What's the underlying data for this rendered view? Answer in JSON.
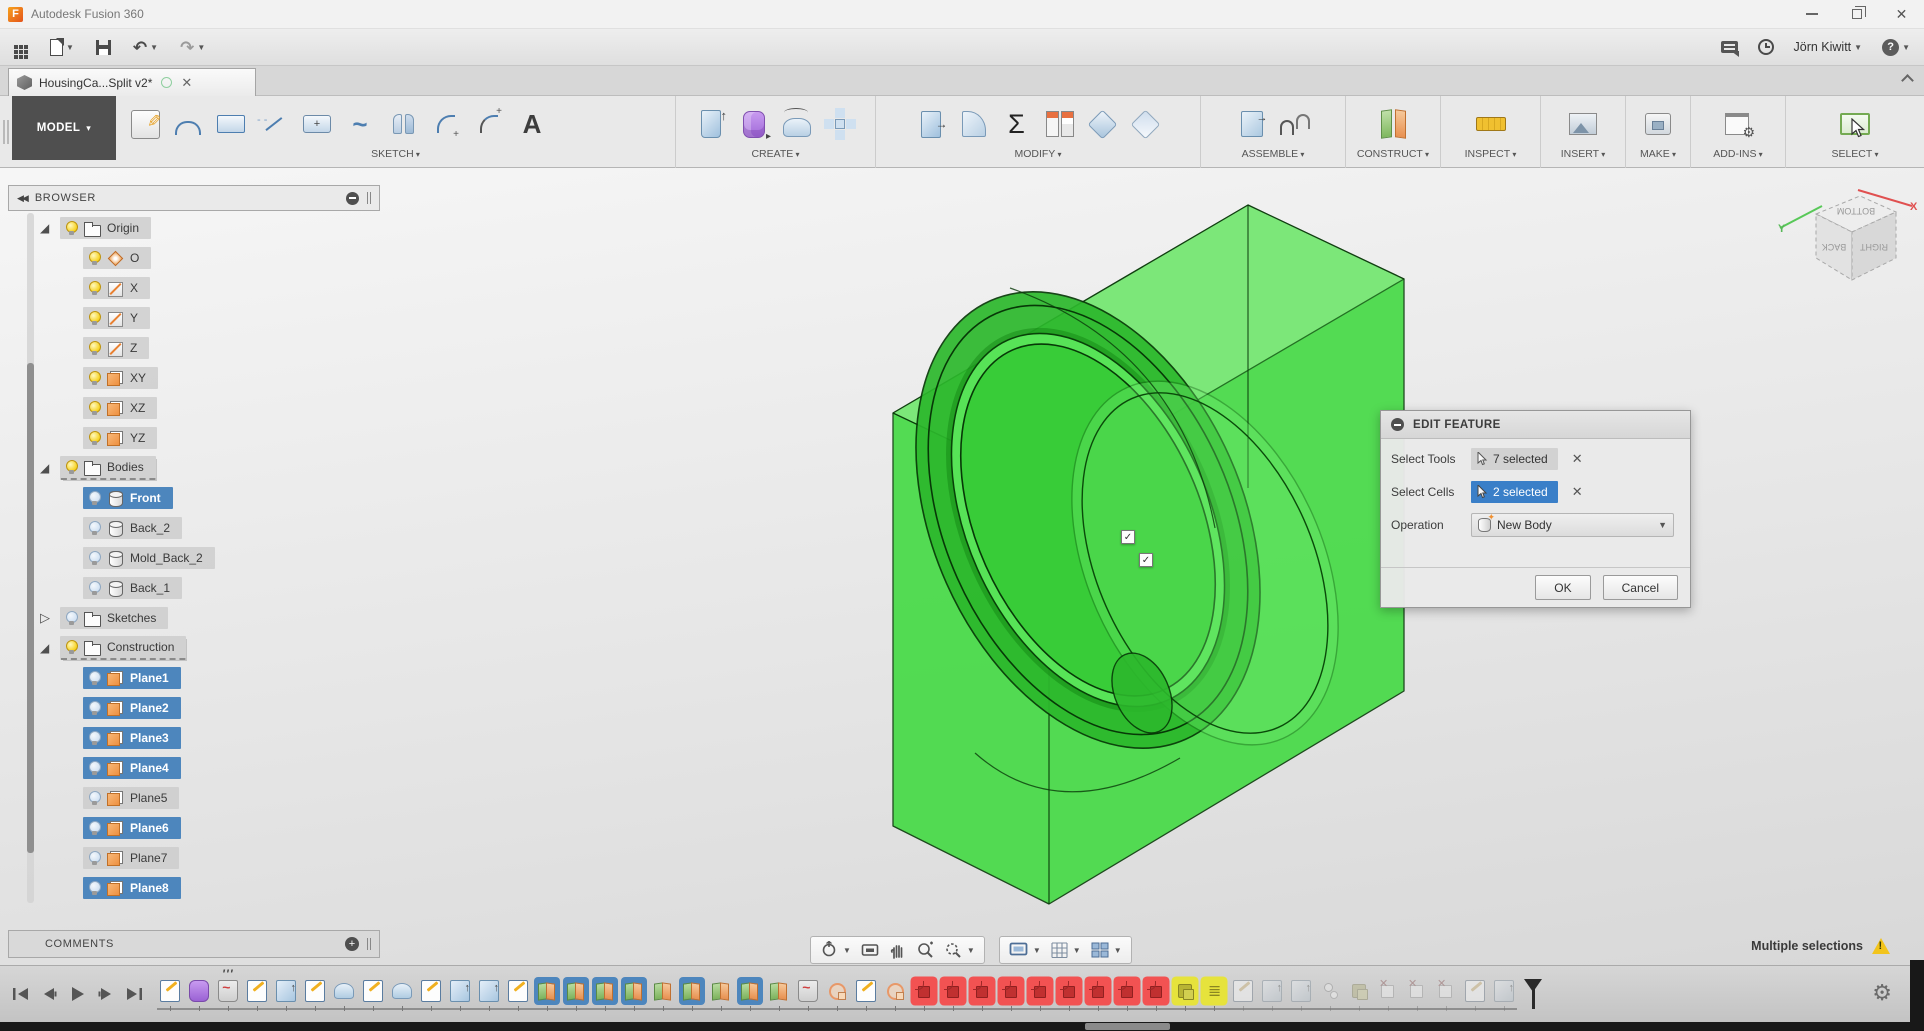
{
  "window": {
    "title": "Autodesk Fusion 360"
  },
  "appbar": {
    "user": "Jörn Kiwitt"
  },
  "tab": {
    "title": "HousingCa...Split v2*"
  },
  "ribbon": {
    "mode": "MODEL",
    "groups": [
      {
        "label": "SKETCH",
        "icons": [
          "create-sketch-icon",
          "arc-icon",
          "rectangle-icon",
          "line-icon",
          "slot-icon",
          "spline-icon",
          "mirror-icon",
          "sketch-fillet-icon",
          "arc-center-icon",
          "text-icon"
        ]
      },
      {
        "label": "CREATE",
        "icons": [
          "extrude-icon",
          "form-icon",
          "revolve-icon",
          "pattern-icon"
        ]
      },
      {
        "label": "MODIFY",
        "icons": [
          "press-pull-icon",
          "fillet-icon",
          "parameters-icon",
          "change-parameters-icon",
          "chamfer-icon",
          "shell-icon"
        ]
      },
      {
        "label": "ASSEMBLE",
        "icons": [
          "new-component-icon",
          "joint-icon"
        ]
      },
      {
        "label": "CONSTRUCT",
        "icons": [
          "construction-plane-icon"
        ]
      },
      {
        "label": "INSPECT",
        "icons": [
          "measure-icon"
        ]
      },
      {
        "label": "INSERT",
        "icons": [
          "attached-canvas-icon"
        ]
      },
      {
        "label": "MAKE",
        "icons": [
          "3d-print-icon"
        ]
      },
      {
        "label": "ADD-INS",
        "icons": [
          "scripts-addins-icon"
        ]
      },
      {
        "label": "SELECT",
        "icons": [
          "select-icon"
        ]
      }
    ]
  },
  "browser": {
    "title": "BROWSER",
    "items": [
      {
        "label": "Origin",
        "level": "lvl1",
        "expand": "open",
        "bulb": "on",
        "icon": "folder",
        "sel": false,
        "dashed": false
      },
      {
        "label": "O",
        "level": "lvl2",
        "expand": "none",
        "bulb": "on",
        "icon": "point",
        "sel": false,
        "dashed": false
      },
      {
        "label": "X",
        "level": "lvl2",
        "expand": "none",
        "bulb": "on",
        "icon": "axis",
        "sel": false,
        "dashed": false
      },
      {
        "label": "Y",
        "level": "lvl2",
        "expand": "none",
        "bulb": "on",
        "icon": "axis",
        "sel": false,
        "dashed": false
      },
      {
        "label": "Z",
        "level": "lvl2",
        "expand": "none",
        "bulb": "on",
        "icon": "axis",
        "sel": false,
        "dashed": false
      },
      {
        "label": "XY",
        "level": "lvl2",
        "expand": "none",
        "bulb": "on",
        "icon": "plane",
        "sel": false,
        "dashed": false
      },
      {
        "label": "XZ",
        "level": "lvl2",
        "expand": "none",
        "bulb": "on",
        "icon": "plane",
        "sel": false,
        "dashed": false
      },
      {
        "label": "YZ",
        "level": "lvl2",
        "expand": "none",
        "bulb": "on",
        "icon": "plane",
        "sel": false,
        "dashed": false
      },
      {
        "label": "Bodies",
        "level": "lvl1",
        "expand": "open",
        "bulb": "on",
        "icon": "folder",
        "sel": false,
        "dashed": true
      },
      {
        "label": "Front",
        "level": "lvl2",
        "expand": "none",
        "bulb": "off",
        "icon": "body",
        "sel": true,
        "dashed": false
      },
      {
        "label": "Back_2",
        "level": "lvl2",
        "expand": "none",
        "bulb": "off",
        "icon": "body",
        "sel": false,
        "dashed": false
      },
      {
        "label": "Mold_Back_2",
        "level": "lvl2",
        "expand": "none",
        "bulb": "off",
        "icon": "body",
        "sel": false,
        "dashed": false
      },
      {
        "label": "Back_1",
        "level": "lvl2",
        "expand": "none",
        "bulb": "off",
        "icon": "body",
        "sel": false,
        "dashed": false
      },
      {
        "label": "Sketches",
        "level": "lvl1",
        "expand": "closed",
        "bulb": "off",
        "icon": "folder",
        "sel": false,
        "dashed": false
      },
      {
        "label": "Construction",
        "level": "lvl1",
        "expand": "open",
        "bulb": "on",
        "icon": "folder",
        "sel": false,
        "dashed": true
      },
      {
        "label": "Plane1",
        "level": "lvl2",
        "expand": "none",
        "bulb": "off",
        "icon": "plane",
        "sel": true,
        "dashed": false
      },
      {
        "label": "Plane2",
        "level": "lvl2",
        "expand": "none",
        "bulb": "off",
        "icon": "plane",
        "sel": true,
        "dashed": false
      },
      {
        "label": "Plane3",
        "level": "lvl2",
        "expand": "none",
        "bulb": "off",
        "icon": "plane",
        "sel": true,
        "dashed": false
      },
      {
        "label": "Plane4",
        "level": "lvl2",
        "expand": "none",
        "bulb": "off",
        "icon": "plane",
        "sel": true,
        "dashed": false
      },
      {
        "label": "Plane5",
        "level": "lvl2",
        "expand": "none",
        "bulb": "off",
        "icon": "plane",
        "sel": false,
        "dashed": false
      },
      {
        "label": "Plane6",
        "level": "lvl2",
        "expand": "none",
        "bulb": "off",
        "icon": "plane",
        "sel": true,
        "dashed": false
      },
      {
        "label": "Plane7",
        "level": "lvl2",
        "expand": "none",
        "bulb": "off",
        "icon": "plane",
        "sel": false,
        "dashed": false
      },
      {
        "label": "Plane8",
        "level": "lvl2",
        "expand": "none",
        "bulb": "off",
        "icon": "plane",
        "sel": true,
        "dashed": false
      }
    ]
  },
  "comments": {
    "title": "COMMENTS"
  },
  "viewcube": {
    "top": "BOTTOM",
    "left": "BACK",
    "right": "RIGHT",
    "axis_x": "X",
    "axis_y": "Y"
  },
  "dialog": {
    "title": "EDIT FEATURE",
    "fields": [
      {
        "label": "Select Tools",
        "value": "7 selected",
        "active": false
      },
      {
        "label": "Select Cells",
        "value": "2 selected",
        "active": true
      }
    ],
    "operation": {
      "label": "Operation",
      "value": "New Body"
    },
    "ok": "OK",
    "cancel": "Cancel"
  },
  "status": {
    "message": "Multiple selections"
  },
  "timeline": {
    "features": [
      {
        "t": "sketch"
      },
      {
        "t": "form"
      },
      {
        "t": "patch marks"
      },
      {
        "t": "sketch"
      },
      {
        "t": "extrude"
      },
      {
        "t": "sketch"
      },
      {
        "t": "revolve"
      },
      {
        "t": "sketch"
      },
      {
        "t": "revolve"
      },
      {
        "t": "sketch"
      },
      {
        "t": "extrude"
      },
      {
        "t": "extrude"
      },
      {
        "t": "sketch"
      },
      {
        "t": "plane sel"
      },
      {
        "t": "plane sel"
      },
      {
        "t": "plane sel"
      },
      {
        "t": "plane sel"
      },
      {
        "t": "plane"
      },
      {
        "t": "plane sel"
      },
      {
        "t": "plane"
      },
      {
        "t": "plane sel"
      },
      {
        "t": "plane"
      },
      {
        "t": "patch"
      },
      {
        "t": "project"
      },
      {
        "t": "sketch"
      },
      {
        "t": "project"
      },
      {
        "t": "split"
      },
      {
        "t": "split"
      },
      {
        "t": "split"
      },
      {
        "t": "split"
      },
      {
        "t": "split"
      },
      {
        "t": "split"
      },
      {
        "t": "split"
      },
      {
        "t": "split"
      },
      {
        "t": "split"
      },
      {
        "t": "combine warn"
      },
      {
        "t": "list warn"
      },
      {
        "t": "sketch dim"
      },
      {
        "t": "extrude dim"
      },
      {
        "t": "extrude dim"
      },
      {
        "t": "point dim"
      },
      {
        "t": "combine dim"
      },
      {
        "t": "delete dim"
      },
      {
        "t": "delete dim"
      },
      {
        "t": "delete dim"
      },
      {
        "t": "sketch dim"
      },
      {
        "t": "extrude dim"
      }
    ]
  }
}
